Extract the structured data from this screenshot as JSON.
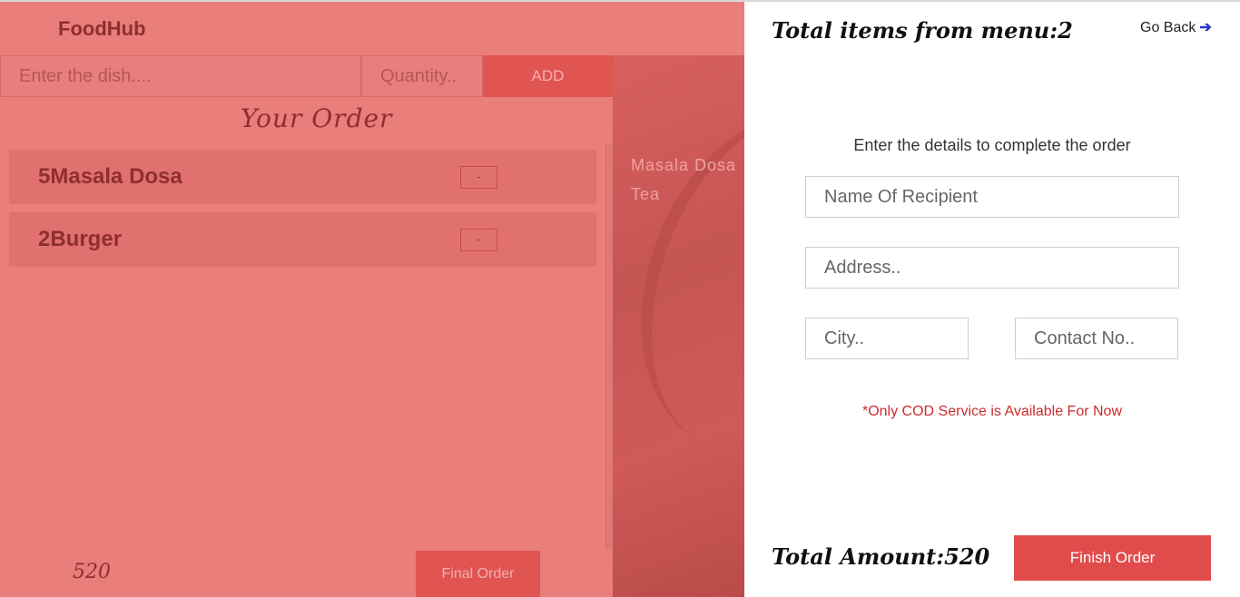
{
  "app": {
    "brand": "FoodHub"
  },
  "order_form": {
    "dish_placeholder": "Enter the dish....",
    "quantity_placeholder": "Quantity..",
    "add_label": "ADD"
  },
  "your_order": {
    "title": "Your Order",
    "items": [
      {
        "label": "5Masala Dosa",
        "remove_label": "-"
      },
      {
        "label": "2Burger",
        "remove_label": "-"
      }
    ],
    "amount": "520",
    "final_order_label": "Final Order"
  },
  "menu_preview": {
    "items": [
      "Masala Dosa",
      "Tea"
    ]
  },
  "checkout": {
    "total_items_text": "Total items from menu:2",
    "go_back_label": "Go Back",
    "heading": "Enter the details to complete the order",
    "name_placeholder": "Name Of Recipient",
    "address_placeholder": "Address..",
    "city_placeholder": "City..",
    "contact_placeholder": "Contact No..",
    "cod_note": "*Only COD Service is Available For Now",
    "total_amount_text": "Total Amount:520",
    "finish_label": "Finish Order"
  },
  "colors": {
    "overlay": "#e97e7b",
    "accent": "#e04c4b",
    "note": "#cc2b2b",
    "go_back_arrow": "#2a38c8"
  },
  "icons": {
    "go_back": "arrow-right-icon"
  }
}
